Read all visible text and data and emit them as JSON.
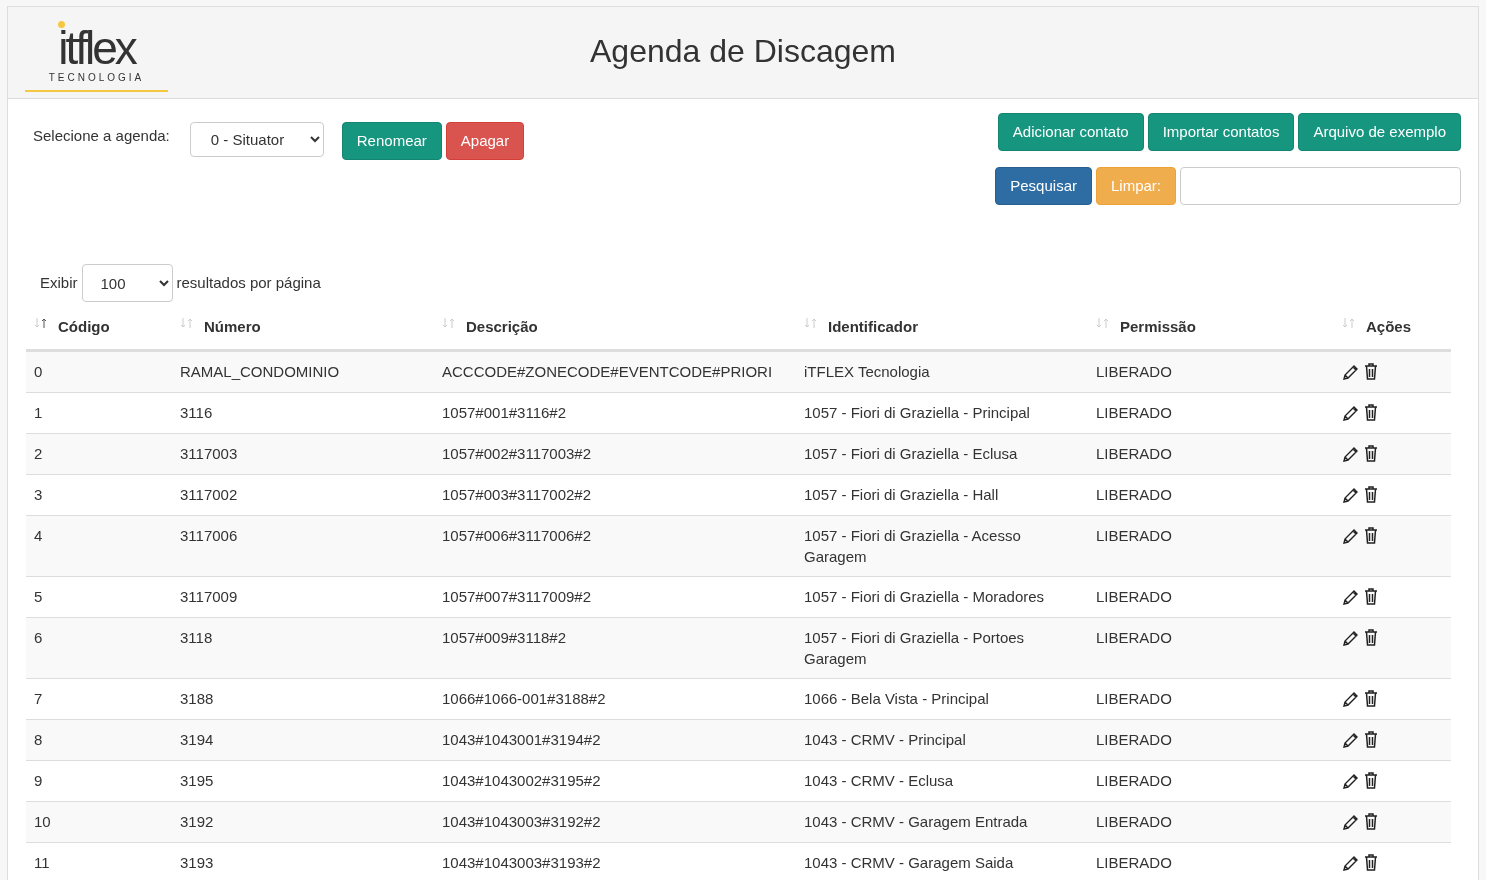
{
  "logo": {
    "wordmark": "itflex",
    "tagline": "TECNOLOGIA"
  },
  "title": "Agenda de Discagem",
  "agenda": {
    "label": "Selecione a agenda:",
    "value": "0 - Situator"
  },
  "agenda_buttons": [
    {
      "label": "Renomear",
      "kind": "teal"
    },
    {
      "label": "Apagar",
      "kind": "red"
    }
  ],
  "top_buttons": [
    {
      "label": "Adicionar contato",
      "kind": "teal"
    },
    {
      "label": "Importar contatos",
      "kind": "teal"
    },
    {
      "label": "Arquivo de exemplo",
      "kind": "teal"
    }
  ],
  "search_buttons": [
    {
      "label": "Pesquisar",
      "kind": "blue"
    },
    {
      "label": "Limpar:",
      "kind": "orange"
    }
  ],
  "page_size": {
    "before": "Exibir",
    "value": "100",
    "after": "resultados por página"
  },
  "table": {
    "columns": [
      {
        "label": "Código",
        "sorted": true
      },
      {
        "label": "Número",
        "sorted": false
      },
      {
        "label": "Descrição",
        "sorted": false
      },
      {
        "label": "Identificador",
        "sorted": false
      },
      {
        "label": "Permissão",
        "sorted": false
      },
      {
        "label": "Ações",
        "sorted": false
      }
    ],
    "rows": [
      [
        "0",
        "RAMAL_CONDOMINIO",
        "ACCCODE#ZONECODE#EVENTCODE#PRIORI",
        "iTFLEX Tecnologia",
        "LIBERADO"
      ],
      [
        "1",
        "3116",
        "1057#001#3116#2",
        "1057 - Fiori di Graziella - Principal",
        "LIBERADO"
      ],
      [
        "2",
        "3117003",
        "1057#002#3117003#2",
        "1057 - Fiori di Graziella - Eclusa",
        "LIBERADO"
      ],
      [
        "3",
        "3117002",
        "1057#003#3117002#2",
        "1057 - Fiori di Graziella - Hall",
        "LIBERADO"
      ],
      [
        "4",
        "3117006",
        "1057#006#3117006#2",
        "1057 - Fiori di Graziella - Acesso Garagem",
        "LIBERADO"
      ],
      [
        "5",
        "3117009",
        "1057#007#3117009#2",
        "1057 - Fiori di Graziella - Moradores",
        "LIBERADO"
      ],
      [
        "6",
        "3118",
        "1057#009#3118#2",
        "1057 - Fiori di Graziella - Portoes Garagem",
        "LIBERADO"
      ],
      [
        "7",
        "3188",
        "1066#1066-001#3188#2",
        "1066 - Bela Vista - Principal",
        "LIBERADO"
      ],
      [
        "8",
        "3194",
        "1043#1043001#3194#2",
        "1043 - CRMV - Principal",
        "LIBERADO"
      ],
      [
        "9",
        "3195",
        "1043#1043002#3195#2",
        "1043 - CRMV - Eclusa",
        "LIBERADO"
      ],
      [
        "10",
        "3192",
        "1043#1043003#3192#2",
        "1043 - CRMV - Garagem Entrada",
        "LIBERADO"
      ],
      [
        "11",
        "3193",
        "1043#1043003#3193#2",
        "1043 - CRMV - Garagem Saida",
        "LIBERADO"
      ]
    ]
  }
}
